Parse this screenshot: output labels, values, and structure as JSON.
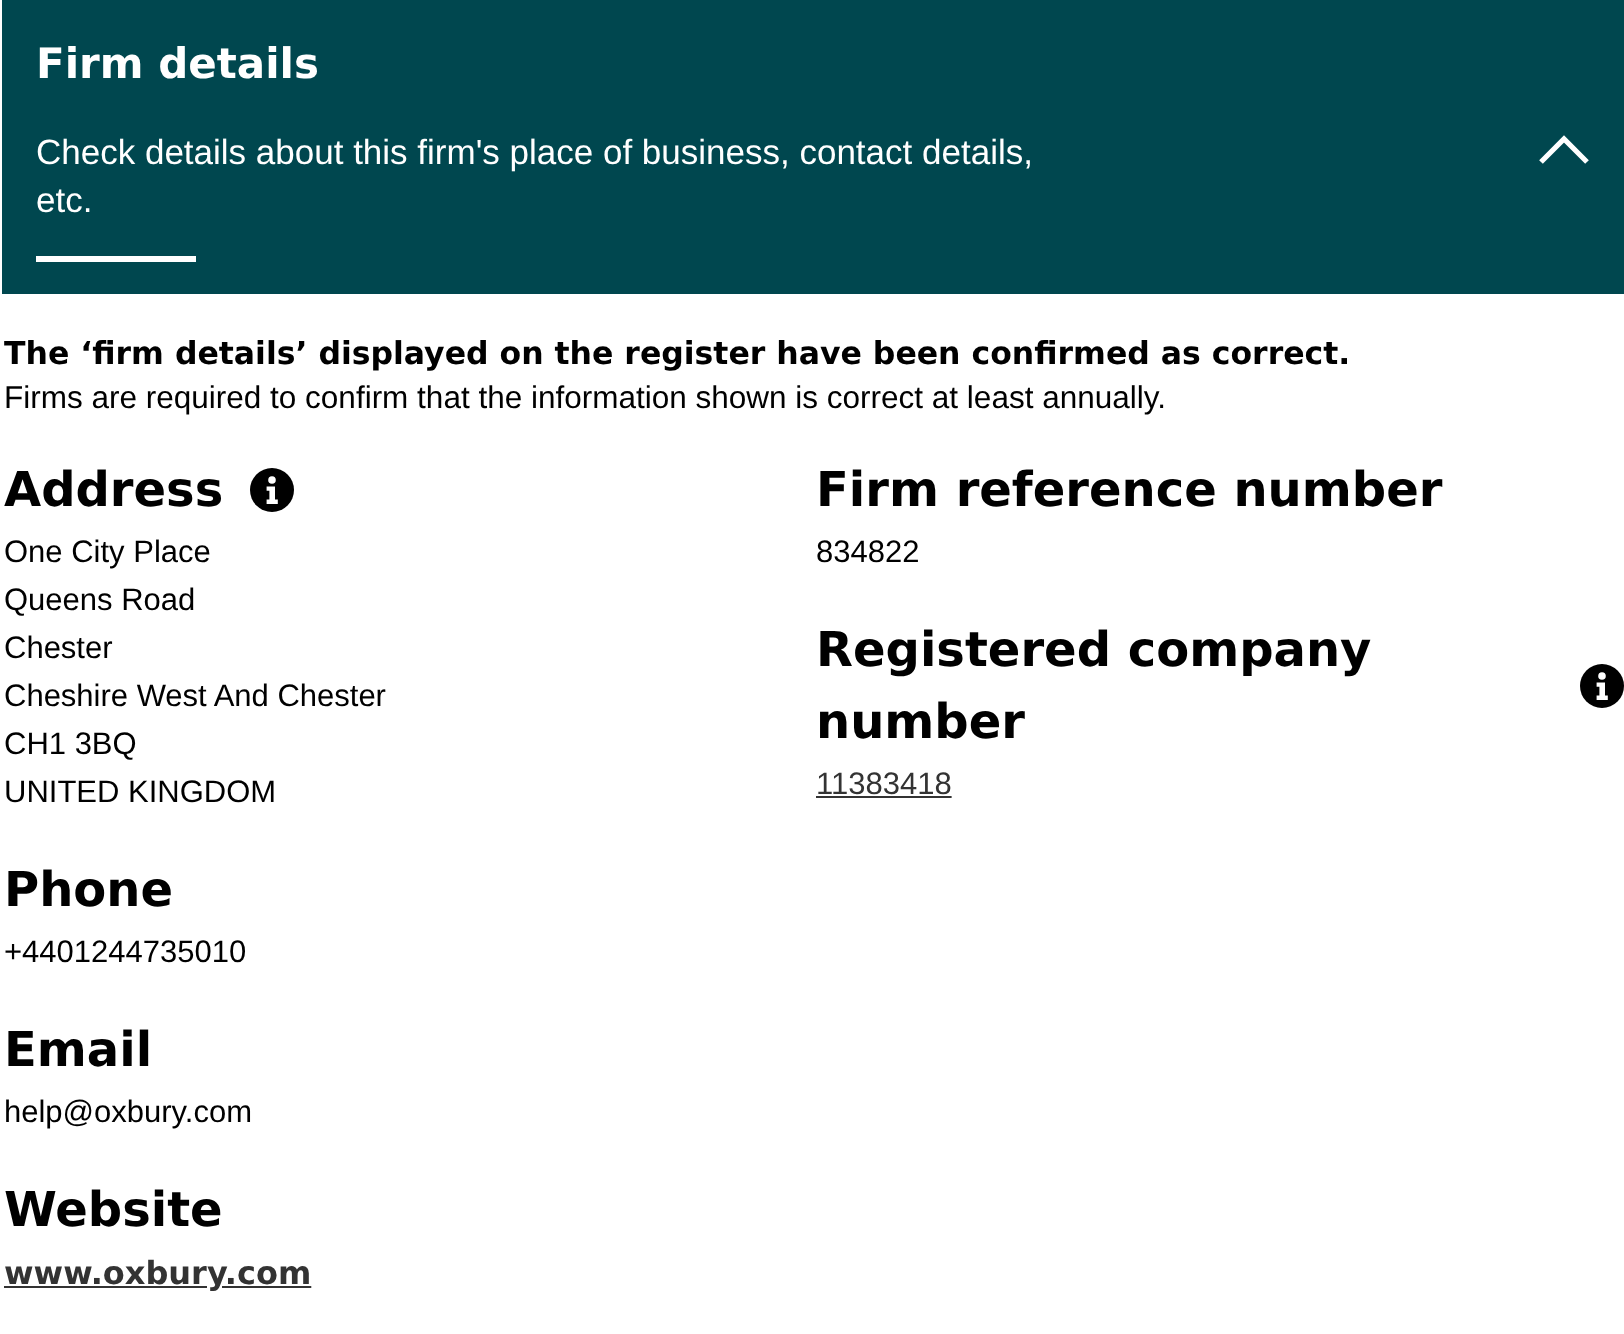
{
  "header": {
    "title": "Firm details",
    "subtitle": "Check details about this firm's place of business, contact details, etc.",
    "expanded": true
  },
  "confirmation": {
    "statement": "The ‘firm details’ displayed on the register have been confirmed as correct.",
    "note": "Firms are required to confirm that the information shown is correct at least annually."
  },
  "columns": [
    {
      "sections": [
        {
          "heading": "Address",
          "info": true,
          "kind": "text",
          "lines": [
            "One City Place",
            "Queens Road",
            "Chester",
            "Cheshire West And Chester",
            "CH1 3BQ",
            "UNITED KINGDOM"
          ]
        },
        {
          "heading": "Phone",
          "info": false,
          "kind": "text",
          "lines": [
            "+4401244735010"
          ]
        },
        {
          "heading": "Email",
          "info": false,
          "kind": "text",
          "lines": [
            "help@oxbury.com"
          ]
        },
        {
          "heading": "Website",
          "info": false,
          "kind": "bold-link",
          "lines": [
            "www.oxbury.com"
          ]
        }
      ]
    },
    {
      "sections": [
        {
          "heading": "Firm reference number",
          "info": false,
          "kind": "text",
          "lines": [
            "834822"
          ]
        },
        {
          "heading": "Registered company number",
          "info": true,
          "kind": "link",
          "lines": [
            "11383418"
          ]
        }
      ]
    }
  ]
}
